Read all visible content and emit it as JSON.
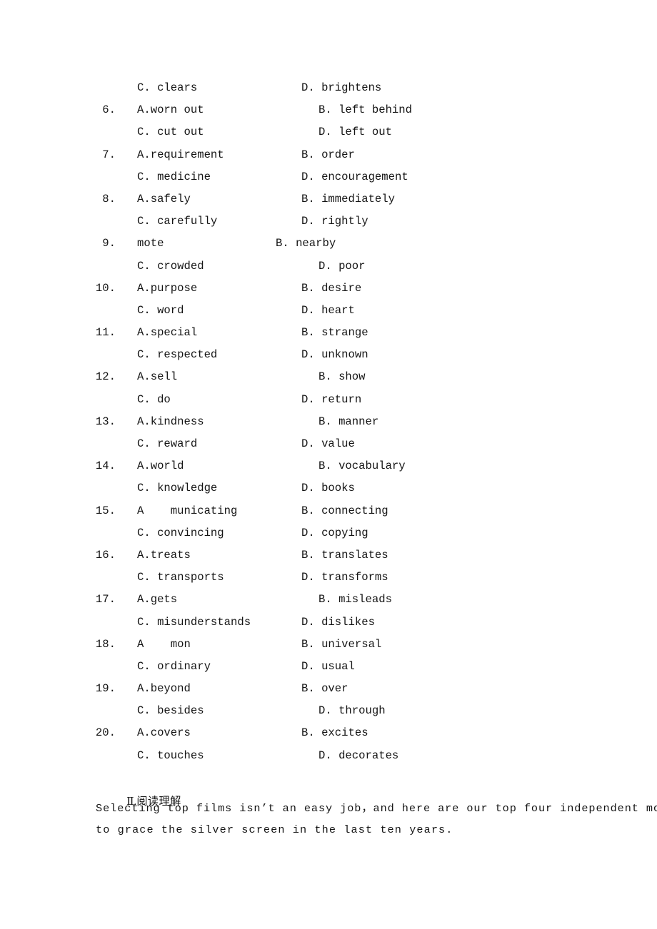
{
  "document": {
    "page_background": "#ffffff",
    "text_color": "#141414"
  },
  "cloze_options": [
    {
      "number": "",
      "left": "C. clears",
      "right": "D. brightens",
      "right_indent": "base"
    },
    {
      "number": "6.",
      "left": "A.worn out",
      "right": "B. left behind",
      "right_indent": "indented"
    },
    {
      "number": "",
      "left": "C. cut out",
      "right": "D. left out",
      "right_indent": "indented"
    },
    {
      "number": "7.",
      "left": "A.requirement",
      "right": "B. order",
      "right_indent": "base"
    },
    {
      "number": "",
      "left": "C. medicine",
      "right": "D. encouragement",
      "right_indent": "base"
    },
    {
      "number": "8.",
      "left": "A.safely",
      "right": "B. immediately",
      "right_indent": "base"
    },
    {
      "number": "",
      "left": "C. carefully",
      "right": "D. rightly",
      "right_indent": "base"
    },
    {
      "number": "9.",
      "left": "mote",
      "right": "B. nearby",
      "right_indent": "outdented"
    },
    {
      "number": "",
      "left": "C. crowded",
      "right": "D. poor",
      "right_indent": "indented"
    },
    {
      "number": "10.",
      "left": "A.purpose",
      "right": "B. desire",
      "right_indent": "base"
    },
    {
      "number": "",
      "left": "C. word",
      "right": "D. heart",
      "right_indent": "base"
    },
    {
      "number": "11.",
      "left": "A.special",
      "right": "B. strange",
      "right_indent": "base"
    },
    {
      "number": "",
      "left": "C. respected",
      "right": "D. unknown",
      "right_indent": "base"
    },
    {
      "number": "12.",
      "left": "A.sell",
      "right": "B. show",
      "right_indent": "indented"
    },
    {
      "number": "",
      "left": "C. do",
      "right": "D. return",
      "right_indent": "base"
    },
    {
      "number": "13.",
      "left": "A.kindness",
      "right": "B. manner",
      "right_indent": "indented"
    },
    {
      "number": "",
      "left": "C. reward",
      "right": "D. value",
      "right_indent": "base"
    },
    {
      "number": "14.",
      "left": "A.world",
      "right": "B. vocabulary",
      "right_indent": "indented"
    },
    {
      "number": "",
      "left": "C. knowledge",
      "right": "D. books",
      "right_indent": "base"
    },
    {
      "number": "15.",
      "left": "A    municating",
      "right": "B. connecting",
      "right_indent": "base"
    },
    {
      "number": "",
      "left": "C. convincing",
      "right": "D. copying",
      "right_indent": "base"
    },
    {
      "number": "16.",
      "left": "A.treats",
      "right": "B. translates",
      "right_indent": "base"
    },
    {
      "number": "",
      "left": "C. transports",
      "right": "D. transforms",
      "right_indent": "base"
    },
    {
      "number": "17.",
      "left": "A.gets",
      "right": "B. misleads",
      "right_indent": "indented"
    },
    {
      "number": "",
      "left": "C. misunderstands",
      "right": "D. dislikes",
      "right_indent": "base"
    },
    {
      "number": "18.",
      "left": "A    mon",
      "right": "B. universal",
      "right_indent": "base"
    },
    {
      "number": "",
      "left": "C. ordinary",
      "right": "D. usual",
      "right_indent": "base"
    },
    {
      "number": "19.",
      "left": "A.beyond",
      "right": "B. over",
      "right_indent": "base"
    },
    {
      "number": "",
      "left": "C. besides",
      "right": "D. through",
      "right_indent": "indented"
    },
    {
      "number": "20.",
      "left": "A.covers",
      "right": "B. excites",
      "right_indent": "base"
    },
    {
      "number": "",
      "left": "C. touches",
      "right": "D. decorates",
      "right_indent": "indented"
    }
  ],
  "section_two": {
    "numeral": "Ⅱ",
    "separator": ".",
    "title": "阅读理解",
    "passage_lines": [
      "Selecting top films isn’t an easy job，and here are our top four independent movies",
      "to grace the silver screen in the last ten years."
    ]
  }
}
